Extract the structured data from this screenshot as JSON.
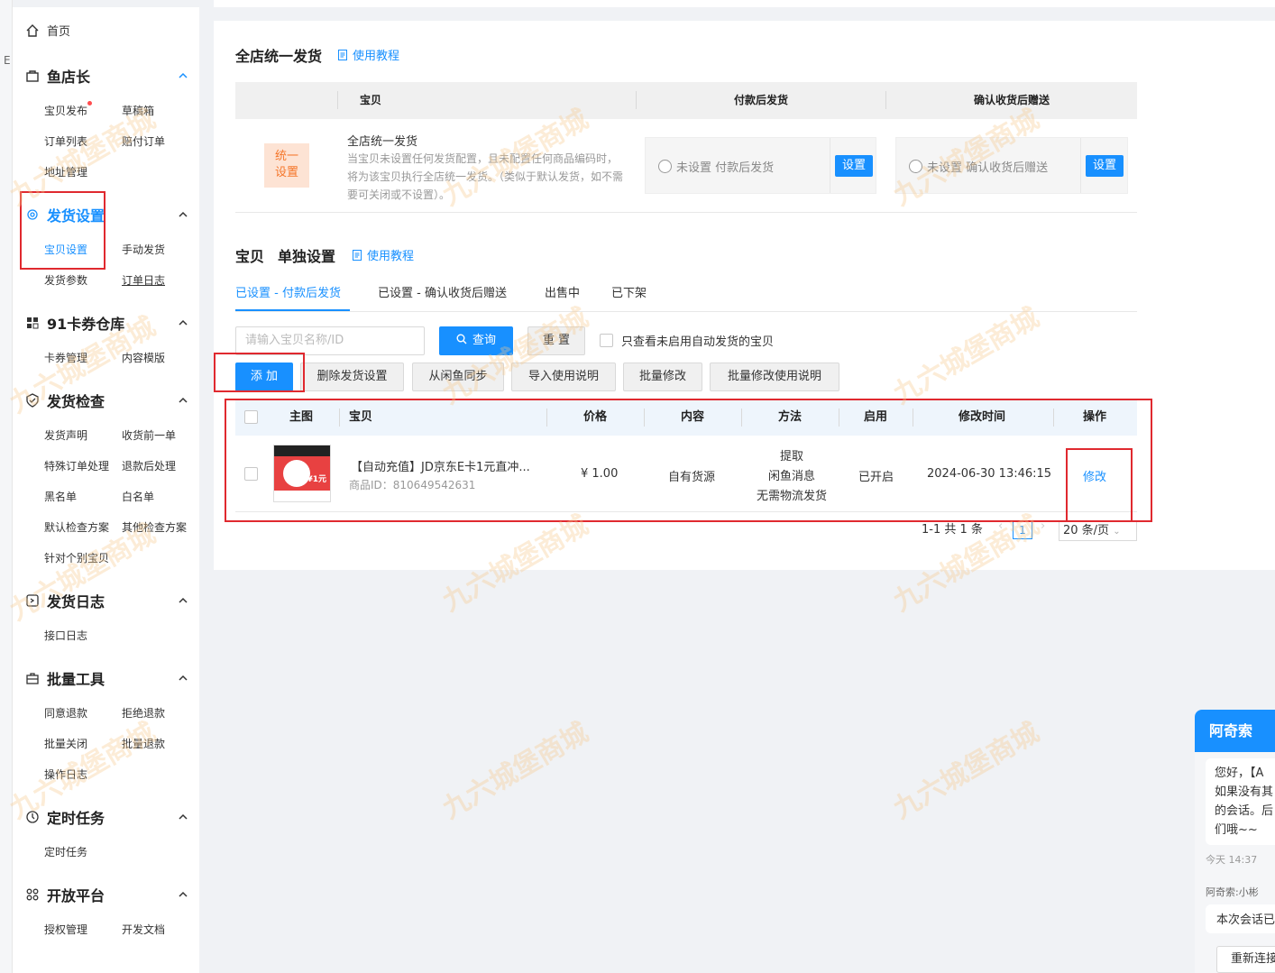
{
  "sidebar": {
    "edge_char": "E",
    "home": "首页",
    "groups": [
      {
        "title": "鱼店长",
        "items": [
          "宝贝发布",
          "草稿箱",
          "订单列表",
          "赔付订单",
          "地址管理"
        ]
      },
      {
        "title": "发货设置",
        "items": [
          "宝贝设置",
          "手动发货",
          "发货参数",
          "订单日志"
        ]
      },
      {
        "title": "91卡券仓库",
        "items": [
          "卡券管理",
          "内容模版"
        ]
      },
      {
        "title": "发货检查",
        "items": [
          "发货声明",
          "收货前一单",
          "特殊订单处理",
          "退款后处理",
          "黑名单",
          "白名单",
          "默认检查方案",
          "其他检查方案",
          "针对个别宝贝"
        ]
      },
      {
        "title": "发货日志",
        "items": [
          "接口日志"
        ]
      },
      {
        "title": "批量工具",
        "items": [
          "同意退款",
          "拒绝退款",
          "批量关闭",
          "批量退款",
          "操作日志"
        ]
      },
      {
        "title": "定时任务",
        "items": [
          "定时任务"
        ]
      },
      {
        "title": "开放平台",
        "items": [
          "授权管理",
          "开发文档"
        ]
      }
    ]
  },
  "store_section": {
    "title": "全店统一发货",
    "tutorial": "使用教程",
    "headers": [
      "宝贝",
      "付款后发货",
      "确认收货后赠送"
    ],
    "tag": "统一设置",
    "tag_line1": "统一",
    "tag_line2": "设置",
    "desc_title": "全店统一发货",
    "desc_text": "当宝贝未设置任何发货配置，且未配置任何商品编码时，将为该宝贝执行全店统一发货。（类似于默认发货，如不需要可关闭或不设置）。",
    "setting1": "未设置 付款后发货",
    "setting2": "未设置 确认收货后赠送",
    "set_btn": "设置"
  },
  "item_section": {
    "title_a": "宝贝",
    "title_b": "单独设置",
    "tutorial": "使用教程",
    "tabs": [
      "已设置 - 付款后发货",
      "已设置 - 确认收货后赠送",
      "出售中",
      "已下架"
    ],
    "search_placeholder": "请输入宝贝名称/ID",
    "query_btn": "查询",
    "reset_btn": "重 置",
    "only_unset": "只查看未启用自动发货的宝贝",
    "actions": [
      "添 加",
      "删除发货设置",
      "从闲鱼同步",
      "导入使用说明",
      "批量修改",
      "批量修改使用说明"
    ],
    "columns": [
      "主图",
      "宝贝",
      "价格",
      "内容",
      "方法",
      "启用",
      "修改时间",
      "操作"
    ],
    "rows": [
      {
        "title": "【自动充值】JD京东E卡1元直冲...",
        "id": "商品ID：810649542631",
        "price": "¥ 1.00",
        "content": "自有货源",
        "method": [
          "提取",
          "闲鱼消息",
          "无需物流发货"
        ],
        "enabled": "已开启",
        "modified": "2024-06-30 13:46:15",
        "action": "修改"
      }
    ],
    "thumb_price": "¥1元",
    "pager": {
      "summary": "1-1 共 1 条",
      "current": "1",
      "page_size": "20 条/页"
    }
  },
  "watermark": "九六城堡商城",
  "chat": {
    "name": "阿奇索",
    "message": "您好，【A 如果没有其 的会话。后 们哦~~",
    "time": "今天 14:37",
    "sender": "阿奇索:小彬",
    "message2": "本次会话已",
    "button": "重新连接"
  },
  "colors": {
    "accent": "#1890ff",
    "highlight_box": "#e0292f",
    "tag_bg": "#fde3d4",
    "tag_text": "#f5762a"
  }
}
